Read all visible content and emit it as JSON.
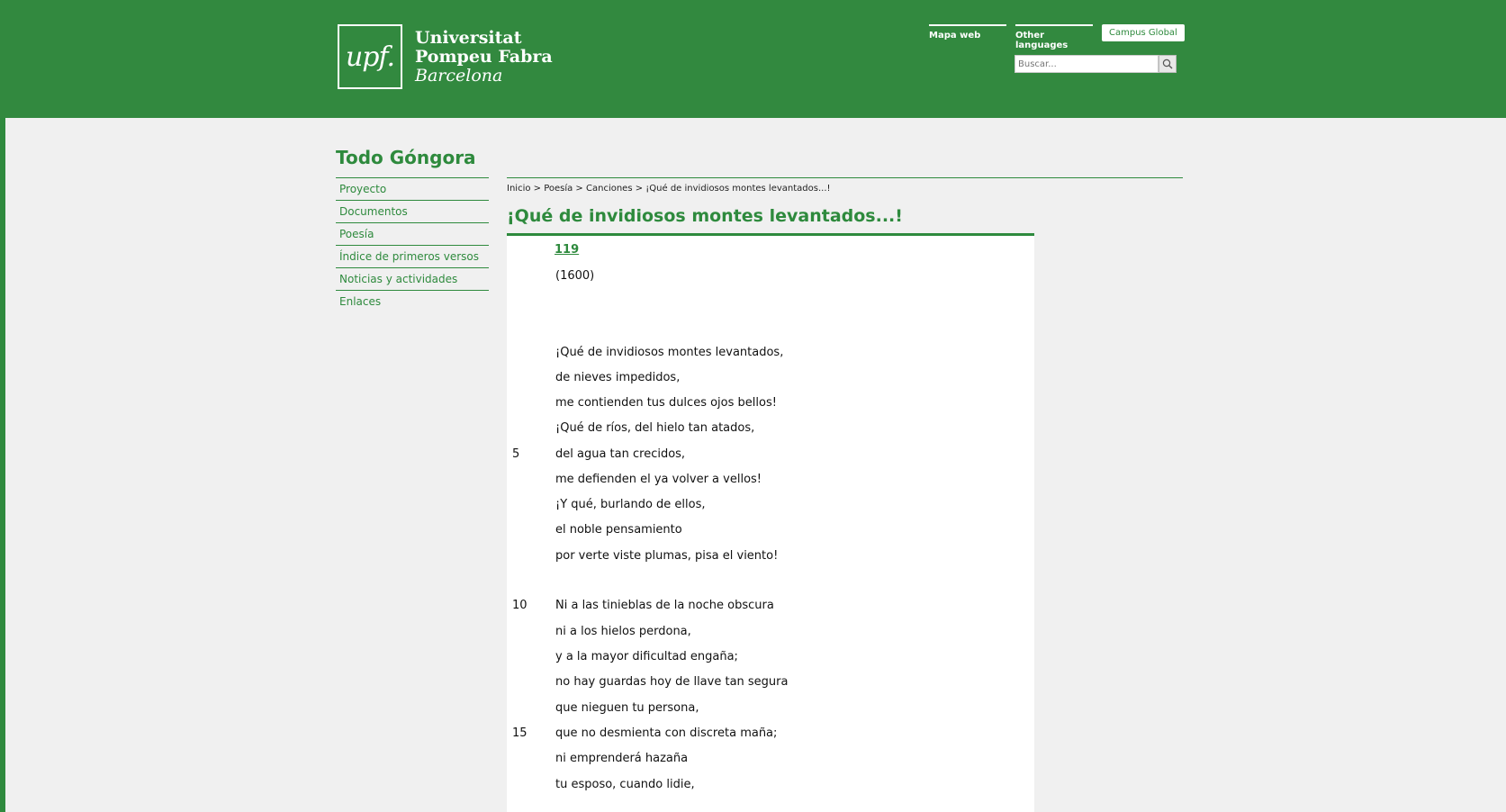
{
  "header": {
    "logo_mark": "upf.",
    "logo_line1": "Universitat",
    "logo_line2": "Pompeu Fabra",
    "logo_line3": "Barcelona",
    "links": [
      "Mapa web",
      "Other languages"
    ],
    "campus_button": "Campus Global",
    "search_placeholder": "Buscar..."
  },
  "site_title": "Todo Góngora",
  "nav": [
    "Proyecto",
    "Documentos",
    "Poesía",
    "Índice de primeros versos",
    "Noticias y actividades",
    "Enlaces"
  ],
  "breadcrumb": "Inicio > Poesía > Canciones > ¡Qué de invidiosos montes levantados...!",
  "page_title": "¡Qué de invidiosos montes levantados...!",
  "poem": {
    "number": "119",
    "year": "(1600)",
    "verses": [
      {
        "n": "",
        "t": "¡Qué de invidiosos montes levantados,"
      },
      {
        "n": "",
        "t": "de nieves impedidos,"
      },
      {
        "n": "",
        "t": "me contienden tus dulces ojos bellos!"
      },
      {
        "n": "",
        "t": "¡Qué de ríos, del hielo tan atados,"
      },
      {
        "n": "5",
        "t": "del agua tan crecidos,"
      },
      {
        "n": "",
        "t": "me defienden el ya volver a vellos!"
      },
      {
        "n": "",
        "t": "¡Y qué, burlando de ellos,"
      },
      {
        "n": "",
        "t": "el noble pensamiento"
      },
      {
        "n": "",
        "t": "por verte viste plumas, pisa el viento!"
      },
      {
        "n": "10",
        "t": "Ni a las tinieblas de la noche obscura"
      },
      {
        "n": "",
        "t": "ni a los hielos perdona,"
      },
      {
        "n": "",
        "t": "y a la mayor dificultad engaña;"
      },
      {
        "n": "",
        "t": "no hay guardas hoy de llave tan segura"
      },
      {
        "n": "",
        "t": "que nieguen tu persona,"
      },
      {
        "n": "15",
        "t": "que no desmienta con discreta maña;"
      },
      {
        "n": "",
        "t": "ni emprenderá hazaña"
      },
      {
        "n": "",
        "t": "tu esposo, cuando lidie,"
      }
    ]
  },
  "colors": {
    "brand_green": "#32893f",
    "background": "#f0f0f0"
  }
}
